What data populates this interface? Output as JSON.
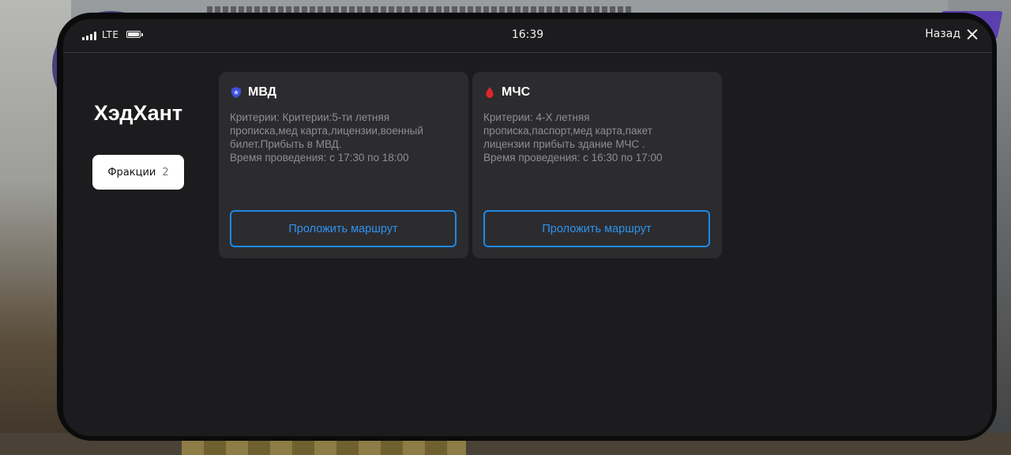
{
  "status_bar": {
    "network": "LTE",
    "time": "16:39",
    "back_label": "Назад"
  },
  "app": {
    "title": "ХэдХант"
  },
  "tabs": [
    {
      "label": "Фракции",
      "count": "2"
    }
  ],
  "factions": [
    {
      "name": "МВД",
      "icon": "police-shield-icon",
      "icon_color": "#3f4fd6",
      "description": "Критерии: Критерии:5-ти летняя\nпрописка,мед карта,лицензии,военный\nбилет.Прибыть в МВД.\nВремя проведения: с 17:30 по 18:00",
      "button_label": "Проложить маршрут"
    },
    {
      "name": "МЧС",
      "icon": "fire-drop-icon",
      "icon_color": "#e0242b",
      "description": "Критерии: 4-Х летняя\nпрописка,паспорт,мед карта,пакет\nлицензии прибыть здание МЧС .\nВремя проведения: с 16:30 по 17:00",
      "button_label": "Проложить маршрут"
    }
  ],
  "colors": {
    "background": "#1c1c1e",
    "card": "#2c2c2f",
    "accent": "#1e88e5",
    "text_secondary": "#8e8e93"
  }
}
